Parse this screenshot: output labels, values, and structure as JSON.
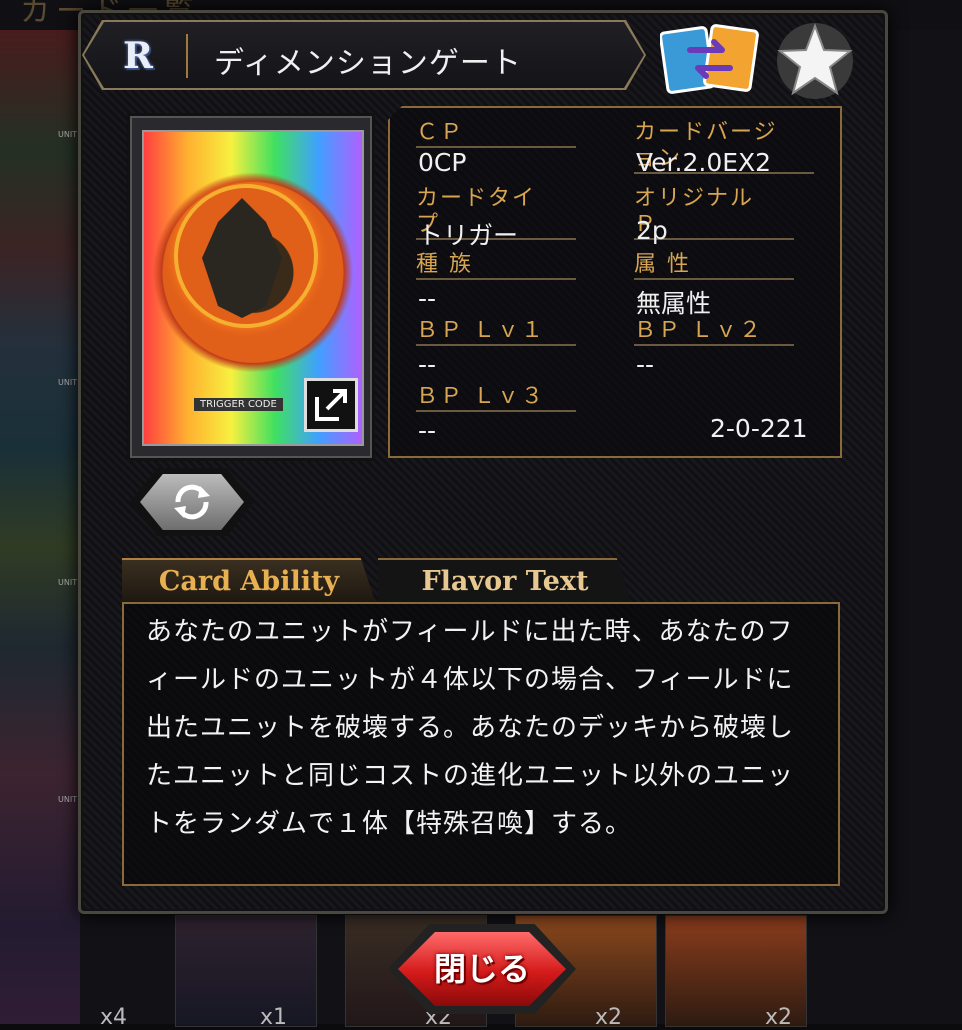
{
  "background": {
    "title": "カード一覧",
    "unit_label": "UNIT",
    "counts": [
      "x4",
      "x1",
      "x2",
      "x2",
      "x2"
    ]
  },
  "header": {
    "rarity": "R",
    "card_name": "ディメンションゲート"
  },
  "icons": {
    "swap": "card-swap-icon",
    "favorite": "star-icon",
    "toggle": "refresh-icon",
    "expand": "expand-icon"
  },
  "card_image": {
    "trigger_label": "TRIGGER CODE"
  },
  "info": {
    "cp_label": "ＣＰ",
    "cp_value": "0CP",
    "version_label": "カードバージョン",
    "version_value": "Ver.2.0EX2",
    "type_label": "カードタイプ",
    "type_value": "トリガー",
    "original_p_label": "オリジナルＰ",
    "original_p_value": "2p",
    "race_label": "種 族",
    "race_value": "--",
    "attribute_label": "属 性",
    "attribute_value": "無属性",
    "bp1_label": "ＢＰ Ｌｖ１",
    "bp1_value": "--",
    "bp2_label": "ＢＰ Ｌｖ２",
    "bp2_value": "--",
    "bp3_label": "ＢＰ Ｌｖ３",
    "bp3_value": "--",
    "card_number": "2-0-221"
  },
  "tabs": {
    "ability": "Card Ability",
    "flavor": "Flavor Text"
  },
  "ability_text": "あなたのユニットがフィールドに出た時、あなたのフィールドのユニットが４体以下の場合、フィールドに出たユニットを破壊する。あなたのデッキから破壊したユニットと同じコストの進化ユニット以外のユニットをランダムで１体【特殊召喚】する。",
  "close_button": "閉じる",
  "colors": {
    "accent_gold": "#d8a550",
    "close_red": "#d41a1a"
  }
}
